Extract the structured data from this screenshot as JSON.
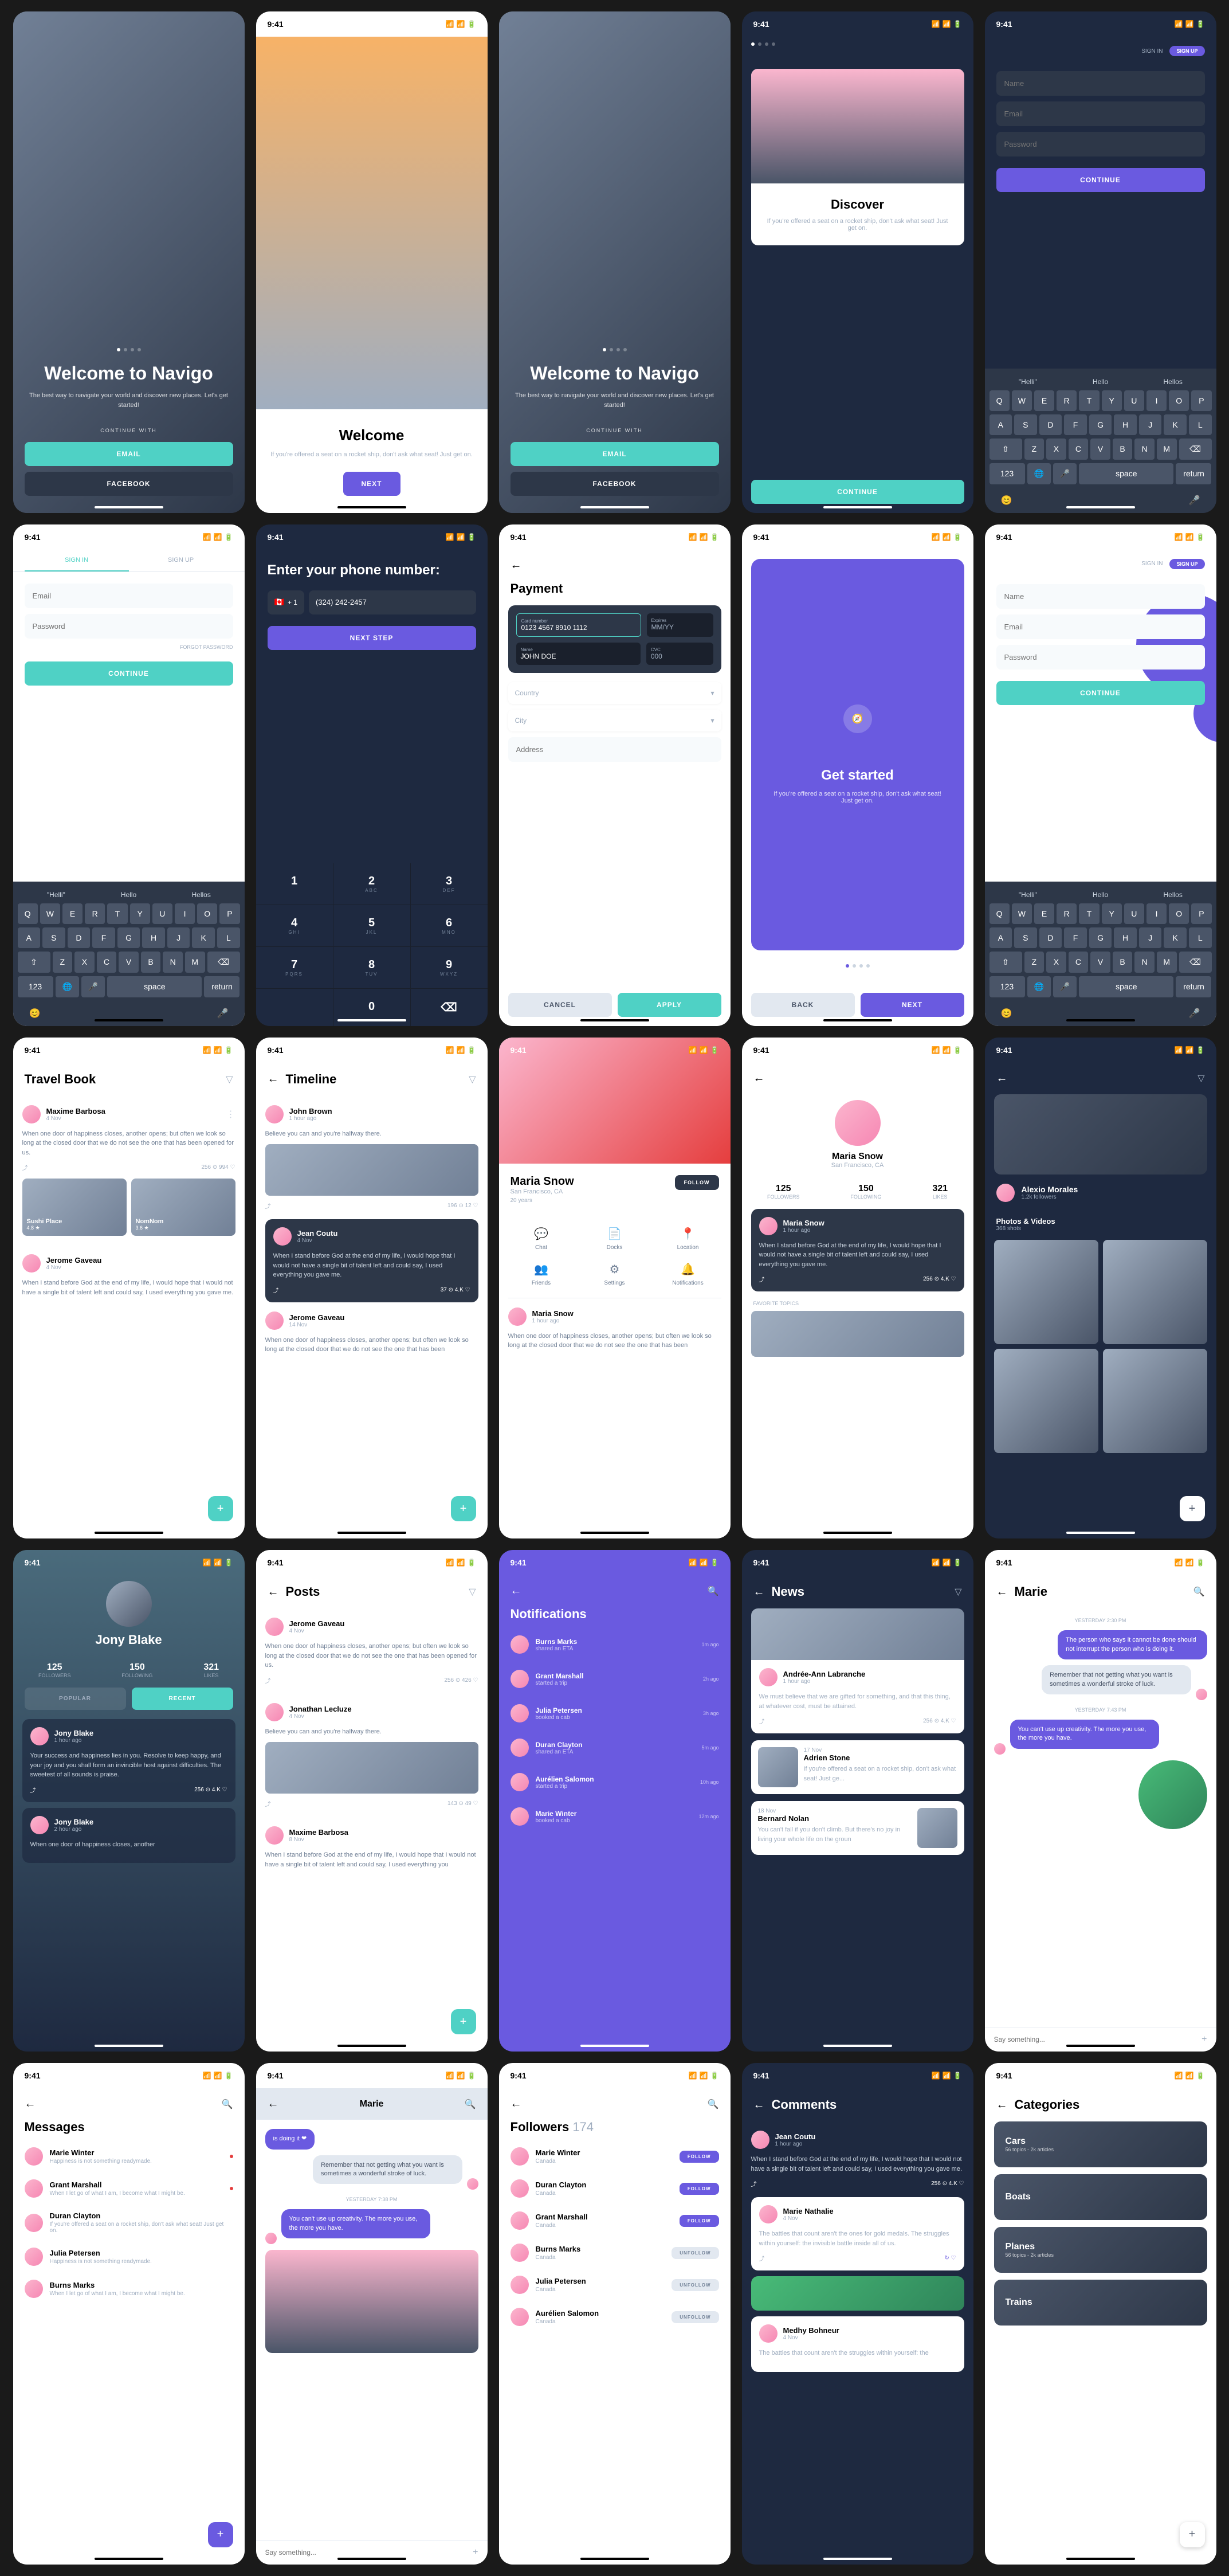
{
  "time": "9:41",
  "welcome": {
    "title": "Welcome to Navigo",
    "subtitle": "The best way to navigate your world and discover new places. Let's get started!",
    "continue_with": "CONTINUE WITH",
    "email": "EMAIL",
    "facebook": "FACEBOOK"
  },
  "welcome2": {
    "title": "Welcome",
    "subtitle": "If you're offered a seat on a rocket ship, don't ask what seat! Just get on.",
    "next": "NEXT"
  },
  "discover": {
    "title": "Discover",
    "subtitle": "If you're offered a seat on a rocket ship, don't ask what seat! Just get on.",
    "continue": "CONTINUE"
  },
  "signup": {
    "signin": "SIGN IN",
    "signup": "SIGN UP",
    "name": "Name",
    "email": "Email",
    "password": "Password",
    "continue": "CONTINUE"
  },
  "signin": {
    "signin": "SIGN IN",
    "signup": "SIGN UP",
    "email": "Email",
    "password": "Password",
    "forgot": "FORGOT PASSWORD",
    "continue": "CONTINUE"
  },
  "phone": {
    "title": "Enter your phone number:",
    "code": "+ 1",
    "number": "(324) 242-2457",
    "next": "NEXT STEP"
  },
  "payment": {
    "title": "Payment",
    "card_label": "Card number",
    "card": "0123 4567 8910 1112",
    "expires_label": "Expires",
    "expires": "MM/YY",
    "name_label": "Name",
    "name": "JOHN DOE",
    "cvc_label": "CVC",
    "cvc": "000",
    "country": "Country",
    "city": "City",
    "address": "Address",
    "cancel": "CANCEL",
    "apply": "APPLY"
  },
  "getstarted": {
    "title": "Get started",
    "subtitle": "If you're offered a seat on a rocket ship, don't ask what seat! Just get on.",
    "back": "BACK",
    "next": "NEXT"
  },
  "keyboard": {
    "sugg": [
      "\"Helli\"",
      "Hello",
      "Hellos"
    ],
    "row1": [
      "Q",
      "W",
      "E",
      "R",
      "T",
      "Y",
      "U",
      "I",
      "O",
      "P"
    ],
    "row2": [
      "A",
      "S",
      "D",
      "F",
      "G",
      "H",
      "J",
      "K",
      "L"
    ],
    "row3": [
      "Z",
      "X",
      "C",
      "V",
      "B",
      "N",
      "M"
    ],
    "num": "123",
    "space": "space",
    "return": "return"
  },
  "numpad": [
    [
      "1",
      ""
    ],
    [
      "2",
      "ABC"
    ],
    [
      "3",
      "DEF"
    ],
    [
      "4",
      "GHI"
    ],
    [
      "5",
      "JKL"
    ],
    [
      "6",
      "MNO"
    ],
    [
      "7",
      "PQRS"
    ],
    [
      "8",
      "TUV"
    ],
    [
      "9",
      "WXYZ"
    ],
    [
      "",
      ""
    ],
    [
      "0",
      ""
    ],
    [
      "⌫",
      ""
    ]
  ],
  "travelbook": {
    "title": "Travel Book",
    "posts": [
      {
        "name": "Maxime Barbosa",
        "time": "4 Nov",
        "text": "When one door of happiness closes, another opens; but often we look so long at the closed door that we do not see the one that has been opened for us.",
        "stats": "256 ⊙  994 ♡",
        "places": [
          {
            "name": "Sushi Place",
            "rating": "4.8 ★"
          },
          {
            "name": "NomNom",
            "rating": "3.6 ★"
          }
        ]
      },
      {
        "name": "Jerome Gaveau",
        "time": "4 Nov",
        "text": "When I stand before God at the end of my life, I would hope that I would not have a single bit of talent left and could say, I used everything you gave me."
      }
    ]
  },
  "timeline": {
    "title": "Timeline",
    "posts": [
      {
        "name": "John Brown",
        "time": "1 hour ago",
        "text": "Believe you can and you're halfway there.",
        "stats": "196 ⊙  12 ♡"
      },
      {
        "name": "Jean Coutu",
        "time": "4 Nov",
        "text": "When I stand before God at the end of my life, I would hope that I would not have a single bit of talent left and could say, I used everything you gave me.",
        "stats": "37 ⊙  4.K ♡"
      },
      {
        "name": "Jerome Gaveau",
        "time": "14 Nov",
        "text": "When one door of happiness closes, another opens; but often we look so long at the closed door that we do not see the one that has been"
      }
    ]
  },
  "profile": {
    "name": "Maria Snow",
    "location": "San Francisco, CA",
    "age": "20 years",
    "follow": "FOLLOW",
    "icons": [
      {
        "icon": "💬",
        "label": "Chat"
      },
      {
        "icon": "📄",
        "label": "Docks"
      },
      {
        "icon": "📍",
        "label": "Location"
      },
      {
        "icon": "👥",
        "label": "Friends"
      },
      {
        "icon": "⚙",
        "label": "Settings"
      },
      {
        "icon": "🔔",
        "label": "Notifications"
      }
    ],
    "post": {
      "name": "Maria Snow",
      "time": "1 hour ago",
      "text": "When one door of happiness closes, another opens; but often we look so long at the closed door that we do not see the one that has been"
    }
  },
  "profile2": {
    "name": "Maria Snow",
    "location": "San Francisco, CA",
    "stats": [
      {
        "n": "125",
        "l": "FOLLOWERS"
      },
      {
        "n": "150",
        "l": "FOLLOWING"
      },
      {
        "n": "321",
        "l": "LIKES"
      }
    ],
    "post": {
      "name": "Maria Snow",
      "time": "1 hour ago",
      "text": "When I stand before God at the end of my life, I would hope that I would not have a single bit of talent left and could say, I used everything you gave me.",
      "stats": "256 ⊙  4.K ♡"
    },
    "topics": "FAVORITE TOPICS"
  },
  "alexio": {
    "name": "Alexio Morales",
    "followers": "1.2k followers",
    "section": "Photos & Videos",
    "count": "368 shots"
  },
  "jony": {
    "name": "Jony Blake",
    "stats": [
      {
        "n": "125",
        "l": "FOLLOWERS"
      },
      {
        "n": "150",
        "l": "FOLLOWING"
      },
      {
        "n": "321",
        "l": "LIKES"
      }
    ],
    "tabs": [
      "POPULAR",
      "RECENT"
    ],
    "posts": [
      {
        "name": "Jony Blake",
        "time": "1 hour ago",
        "text": "Your success and happiness lies in you. Resolve to keep happy, and your joy and you shall form an invincible host against difficulties. The sweetest of all sounds is praise.",
        "stats": "256 ⊙  4.K ♡"
      },
      {
        "name": "Jony Blake",
        "time": "2 hour ago",
        "text": "When one door of happiness closes, another"
      }
    ]
  },
  "posts": {
    "title": "Posts",
    "items": [
      {
        "name": "Jerome Gaveau",
        "time": "4 Nov",
        "text": "When one door of happiness closes, another opens; but often we look so long at the closed door that we do not see the one that has been opened for us.",
        "stats": "256 ⊙  426 ♡"
      },
      {
        "name": "Jonathan Lecluze",
        "time": "4 Nov",
        "text": "Believe you can and you're halfway there.",
        "stats": "143 ⊙  49 ♡"
      },
      {
        "name": "Maxime Barbosa",
        "time": "8 Nov",
        "text": "When I stand before God at the end of my life, I would hope that I would not have a single bit of talent left and could say, I used everything you"
      }
    ]
  },
  "notifications": {
    "title": "Notifications",
    "items": [
      {
        "name": "Burns Marks",
        "action": "shared an ETA",
        "time": "1m ago"
      },
      {
        "name": "Grant Marshall",
        "action": "started a trip",
        "time": "2h ago"
      },
      {
        "name": "Julia Petersen",
        "action": "booked a cab",
        "time": "3h ago"
      },
      {
        "name": "Duran Clayton",
        "action": "shared an ETA",
        "time": "5m ago"
      },
      {
        "name": "Aurélien Salomon",
        "action": "started a trip",
        "time": "10h ago"
      },
      {
        "name": "Marie Winter",
        "action": "booked a cab",
        "time": "12m ago"
      }
    ]
  },
  "news": {
    "title": "News",
    "items": [
      {
        "name": "Andrée-Ann Labranche",
        "time": "1 hour ago",
        "text": "We must believe that we are gifted for something, and that this thing, at whatever cost, must be attained.",
        "stats": "256 ⊙  4.K ♡"
      },
      {
        "name": "Adrien Stone",
        "time": "17 Nov",
        "text": "If you're offered a seat on a rocket ship, don't ask what seat! Just ge..."
      },
      {
        "name": "Bernard Nolan",
        "time": "18 Nov",
        "text": "You can't fall if you don't climb. But there's no joy in living your whole life on the groun"
      }
    ]
  },
  "marie": {
    "title": "Marie",
    "day1": "YESTERDAY 2:30 PM",
    "msg1": "The person who says it cannot be done should not interrupt the person who is doing it.",
    "msg2": "Remember that not getting what you want is sometimes a wonderful stroke of luck.",
    "day2": "YESTERDAY 7:43 PM",
    "msg3": "You can't use up creativity. The more you use, the more you have.",
    "input": "Say something..."
  },
  "messages": {
    "title": "Messages",
    "items": [
      {
        "name": "Marie Winter",
        "text": "Happiness is not something readymade.",
        "dot": true
      },
      {
        "name": "Grant Marshall",
        "text": "When I let go of what I am, I become what I might be.",
        "dot": true
      },
      {
        "name": "Duran Clayton",
        "text": "If you're offered a seat on a rocket ship, don't ask what seat! Just get on."
      },
      {
        "name": "Julia Petersen",
        "text": "Happiness is not something readymade."
      },
      {
        "name": "Burns Marks",
        "text": "When I let go of what I am, I become what I might be."
      }
    ]
  },
  "marie2": {
    "title": "Marie",
    "msg0": "is doing it ❤",
    "msg1": "Remember that not getting what you want is sometimes a wonderful stroke of luck.",
    "day": "YESTERDAY 7:38 PM",
    "msg2": "You can't use up creativity. The more you use, the more you have.",
    "input": "Say something..."
  },
  "followers": {
    "title": "Followers",
    "count": "174",
    "items": [
      {
        "name": "Marie Winter",
        "loc": "Canada",
        "btn": "FOLLOW",
        "primary": true
      },
      {
        "name": "Duran Clayton",
        "loc": "Canada",
        "btn": "FOLLOW",
        "primary": true
      },
      {
        "name": "Grant Marshall",
        "loc": "Canada",
        "btn": "FOLLOW",
        "primary": true
      },
      {
        "name": "Burns Marks",
        "loc": "Canada",
        "btn": "UNFOLLOW"
      },
      {
        "name": "Julia Petersen",
        "loc": "Canada",
        "btn": "UNFOLLOW"
      },
      {
        "name": "Aurélien Salomon",
        "loc": "Canada",
        "btn": "UNFOLLOW"
      }
    ]
  },
  "comments": {
    "title": "Comments",
    "main": {
      "name": "Jean Coutu",
      "time": "1 hour ago",
      "text": "When I stand before God at the end of my life, I would hope that I would not have a single bit of talent left and could say, I used everything you gave me.",
      "stats": "256 ⊙  4.K ♡"
    },
    "replies": [
      {
        "name": "Marie Nathalie",
        "time": "4 Nov",
        "text": "The battles that count aren't the ones for gold medals. The struggles within yourself: the invisible battle inside all of us."
      },
      {
        "name": "Medhy Bohneur",
        "time": "4 Nov",
        "text": "The battles that count aren't the struggles within yourself: the"
      }
    ]
  },
  "categories": {
    "title": "Categories",
    "items": [
      {
        "name": "Cars",
        "sub": "56 topics - 2k articles"
      },
      {
        "name": "Boats",
        "sub": ""
      },
      {
        "name": "Planes",
        "sub": "56 topics - 2k articles"
      },
      {
        "name": "Trains",
        "sub": ""
      }
    ]
  }
}
